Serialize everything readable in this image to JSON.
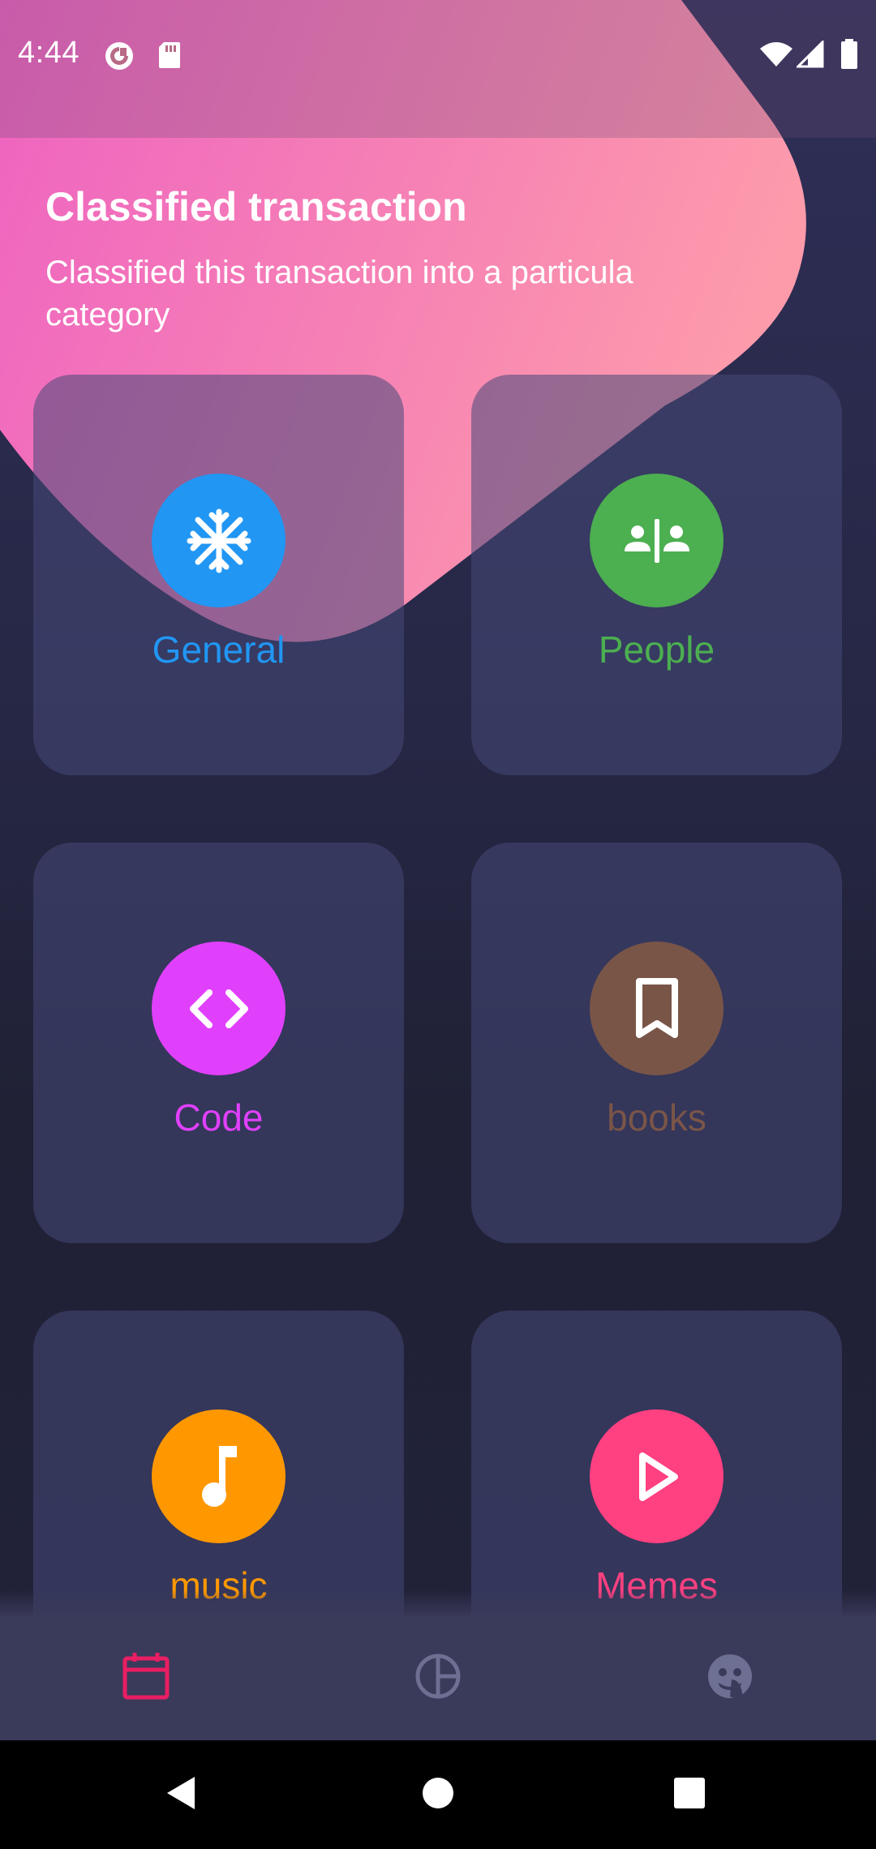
{
  "status_bar": {
    "time": "4:44",
    "left_icons": [
      "pocket-casts-icon",
      "sd-card-icon"
    ],
    "right_icons": [
      "wifi-icon",
      "cell-signal-icon",
      "battery-icon"
    ]
  },
  "header": {
    "title": "Classified transaction",
    "subtitle": "Classified this transaction into a particula category"
  },
  "categories": [
    {
      "label": "General",
      "icon": "snowflake-icon",
      "color": "#2196f3"
    },
    {
      "label": "People",
      "icon": "people-divider-icon",
      "color": "#4caf50"
    },
    {
      "label": "Code",
      "icon": "code-icon",
      "color": "#e040fb"
    },
    {
      "label": "books",
      "icon": "bookmark-icon",
      "color": "#795548"
    },
    {
      "label": "music",
      "icon": "music-note-icon",
      "color": "#ff9800"
    },
    {
      "label": "Memes",
      "icon": "play-icon",
      "color": "#ff4081"
    }
  ],
  "bottom_nav": {
    "items": [
      {
        "icon": "calendar-icon",
        "selected": true,
        "color": "#e91e63"
      },
      {
        "icon": "pie-chart-icon",
        "selected": false,
        "color": "#6d6f93"
      },
      {
        "icon": "face-icon",
        "selected": false,
        "color": "#6d6f93"
      }
    ]
  },
  "system_nav": {
    "items": [
      "back-icon",
      "home-icon",
      "recents-icon"
    ]
  },
  "colors": {
    "blob_pink": "#f06bbf",
    "blob_salmon": "#fb9aae",
    "background_top": "#2f2f58",
    "background_bottom": "#21223a",
    "card": "#3a3a5e",
    "nav_bar": "#3a3a5a"
  }
}
